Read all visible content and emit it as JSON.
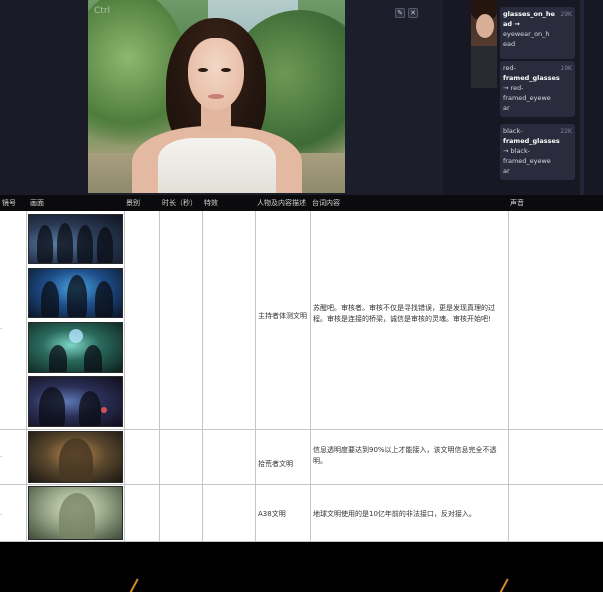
{
  "photo": {
    "corner_tag": "Ctrl"
  },
  "toolbar": {
    "edit_icon": "✎",
    "close_icon": "✕"
  },
  "tags": [
    {
      "lines": [
        "glasses_on_he",
        "ad →",
        "eyewear_on_h",
        "ead"
      ],
      "count": "29K"
    },
    {
      "lines": [
        "red-",
        "framed_glasses",
        "→ red-",
        "framed_eyewe",
        "ar"
      ],
      "count": "19K"
    },
    {
      "lines": [
        "black-",
        "framed_glasses",
        "→ black-",
        "framed_eyewe",
        "ar"
      ],
      "count": "22K"
    }
  ],
  "table": {
    "headers": {
      "no": "镜号",
      "picture": "画面",
      "ref": "景别",
      "duration": "时长（秒）",
      "sfx": "特效",
      "character": "人物及内容描述",
      "dialogue": "台词内容",
      "sound": "声音"
    },
    "rows": [
      {
        "character": "主持者体测文明",
        "dialogue": "苏醒吧。审核者。审核不仅是寻找错误，更是发现真理的过程。审核是连接的桥梁，诚信是审核的灵魂。审核开始吧!"
      },
      {
        "character": "拾荒者文明",
        "dialogue": "信息透明度要达到90%以上才能接入，该文明信息完全不透明。"
      },
      {
        "character": "A38文明",
        "dialogue": "地球文明使用的是10亿年前的非法接口，反对接入。"
      }
    ]
  }
}
